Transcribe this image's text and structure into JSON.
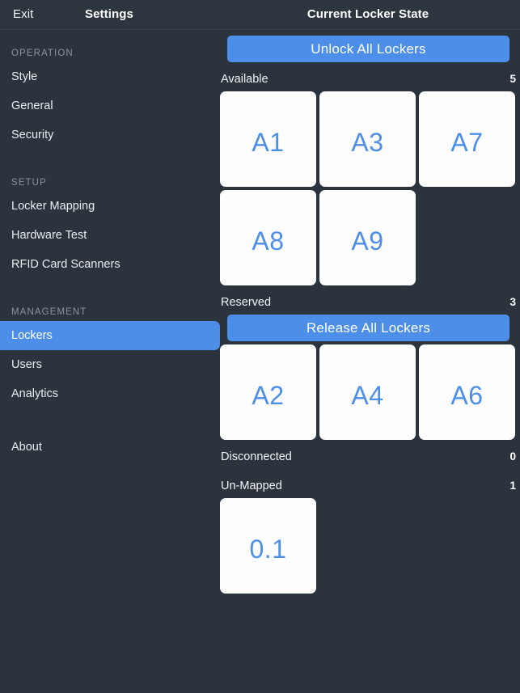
{
  "topbar": {
    "exit_label": "Exit",
    "settings_label": "Settings",
    "title": "Current Locker State"
  },
  "sidebar": {
    "groups": [
      {
        "label": "OPERATION",
        "items": [
          {
            "label": "Style",
            "selected": false
          },
          {
            "label": "General",
            "selected": false
          },
          {
            "label": "Security",
            "selected": false
          }
        ]
      },
      {
        "label": "SETUP",
        "items": [
          {
            "label": "Locker Mapping",
            "selected": false
          },
          {
            "label": "Hardware Test",
            "selected": false
          },
          {
            "label": "RFID Card Scanners",
            "selected": false
          }
        ]
      },
      {
        "label": "MANAGEMENT",
        "items": [
          {
            "label": "Lockers",
            "selected": true
          },
          {
            "label": "Users",
            "selected": false
          },
          {
            "label": "Analytics",
            "selected": false
          }
        ]
      }
    ],
    "about_label": "About"
  },
  "main": {
    "unlock_all_label": "Unlock All Lockers",
    "release_all_label": "Release All Lockers",
    "sections": [
      {
        "label": "Available",
        "count": "5",
        "tiles": [
          "A1",
          "A3",
          "A7",
          "A8",
          "A9"
        ]
      },
      {
        "label": "Reserved",
        "count": "3",
        "tiles": [
          "A2",
          "A4",
          "A6"
        ]
      },
      {
        "label": "Disconnected",
        "count": "0",
        "tiles": []
      },
      {
        "label": "Un-Mapped",
        "count": "1",
        "tiles": [
          "0.1"
        ]
      }
    ]
  },
  "colors": {
    "accent": "#4d8fe8",
    "background": "#2b343c",
    "topbar": "#2d363e",
    "tile": "#fdfdfd",
    "group_label": "#8b949c"
  }
}
